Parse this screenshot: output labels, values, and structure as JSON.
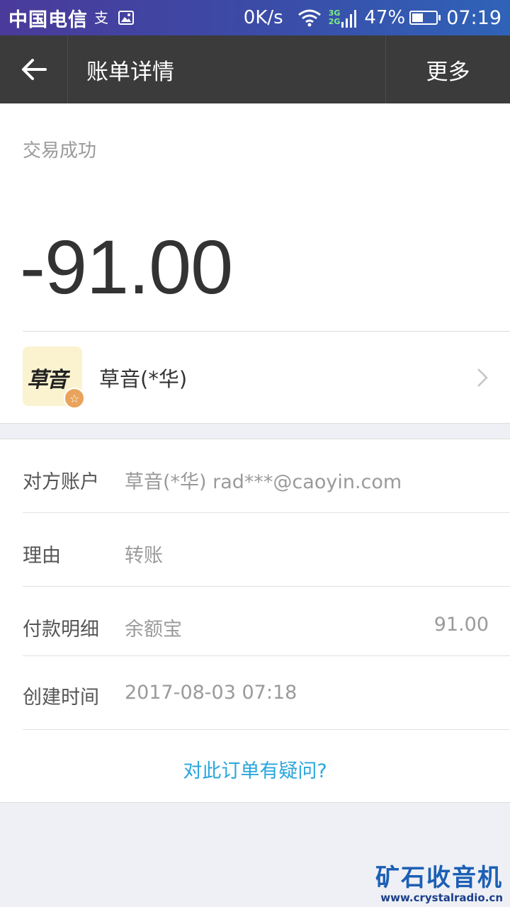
{
  "status_bar": {
    "carrier": "中国电信",
    "net_speed": "0K/s",
    "net_gen_top": "3G",
    "net_gen_bottom": "2G",
    "battery_pct": "47%",
    "battery_level": 0.47,
    "time": "07:19",
    "icons": [
      "alipay-icon",
      "image-icon",
      "wifi-icon",
      "signal-icon",
      "battery-icon"
    ]
  },
  "title_bar": {
    "title": "账单详情",
    "more_label": "更多",
    "back_icon": "back-arrow-icon"
  },
  "summary": {
    "status": "交易成功",
    "amount": "-91.00",
    "merchant": {
      "name": "草音(*华)",
      "logo_text": "草音"
    }
  },
  "details": {
    "rows": [
      {
        "label": "对方账户",
        "value": "草音(*华) rad***@caoyin.com",
        "amount": ""
      },
      {
        "label": "理由",
        "value": "转账",
        "amount": ""
      },
      {
        "label": "付款明细",
        "value": "余额宝",
        "amount": "91.00"
      },
      {
        "label": "创建时间",
        "value": "2017-08-03 07:18",
        "amount": ""
      }
    ],
    "question_link": "对此订单有疑问?"
  },
  "watermark": {
    "line1": "矿石收音机",
    "line2": "www.crystalradio.cn"
  },
  "colors": {
    "title_bar_bg": "#3b3b3b",
    "link": "#2aa6dd",
    "page_bg": "#eef0f5"
  }
}
